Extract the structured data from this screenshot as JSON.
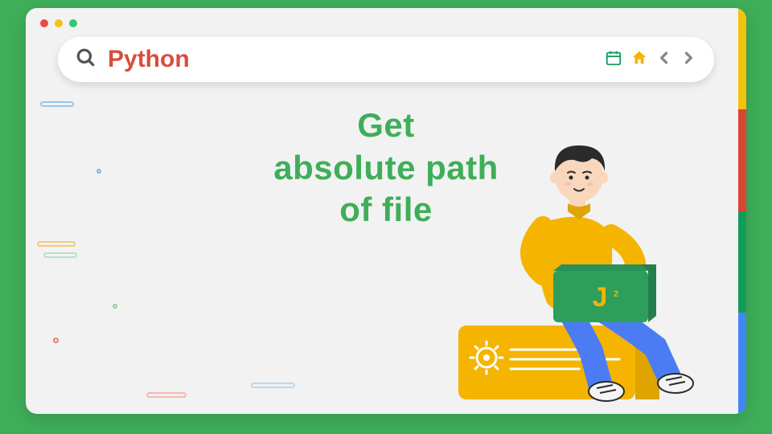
{
  "search": {
    "query": "Python"
  },
  "headline": {
    "line1": "Get",
    "line2": "absolute path",
    "line3": "of file"
  },
  "icons": {
    "search": "search-icon",
    "calendar": "calendar-icon",
    "home": "home-icon",
    "prev": "chevron-left-icon",
    "next": "chevron-right-icon"
  },
  "colors": {
    "page_bg": "#3FAE59",
    "window_bg": "#F2F2F2",
    "brand_text": "#D84D3E",
    "headline": "#3FAE59",
    "stripe": [
      "#F4C20D",
      "#DB4437",
      "#0F9D58",
      "#4285F4"
    ]
  }
}
